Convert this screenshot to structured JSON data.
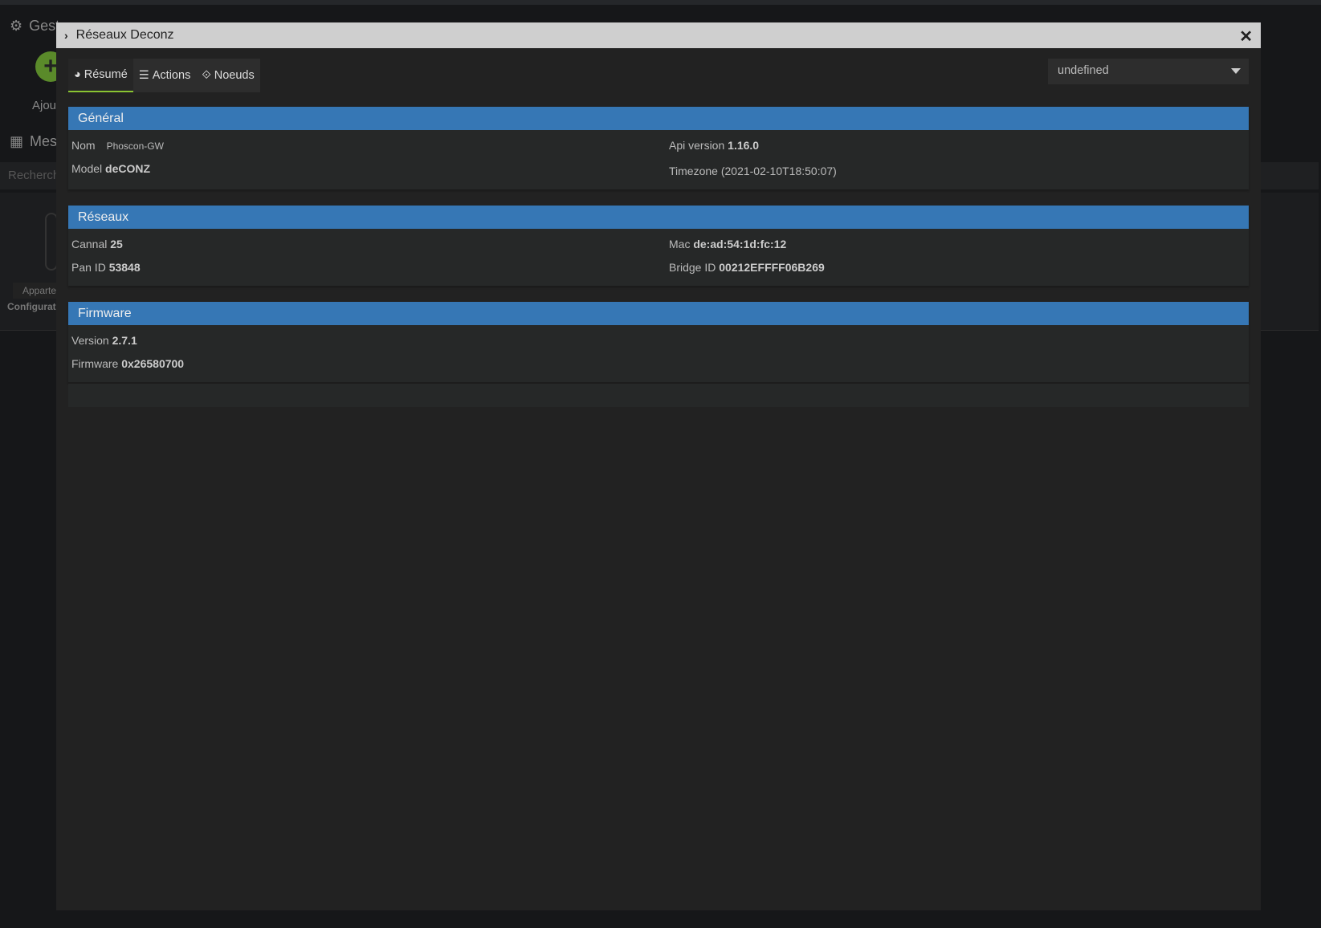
{
  "background": {
    "title": "Gest",
    "add_label": "Ajou",
    "section": "Mes",
    "search_placeholder": "Recherch",
    "device_tag": "Apparte",
    "device_label": "Configurati"
  },
  "modal": {
    "title": "Réseaux Deconz",
    "tabs": [
      {
        "label": "Résumé",
        "icon": "dashboard-icon",
        "active": true
      },
      {
        "label": "Actions",
        "icon": "sliders-icon"
      },
      {
        "label": "Noeuds",
        "icon": "cube-icon"
      }
    ],
    "select_value": "undefined"
  },
  "sections": {
    "general": {
      "title": "Général",
      "nom_label": "Nom",
      "nom_value": "Phoscon-GW",
      "model_label": "Model",
      "model_value": "deCONZ",
      "api_label": "Api version",
      "api_value": "1.16.0",
      "timezone": "Timezone (2021-02-10T18:50:07)"
    },
    "reseaux": {
      "title": "Réseaux",
      "cannal_label": "Cannal",
      "cannal_value": "25",
      "pan_label": "Pan ID",
      "pan_value": "53848",
      "mac_label": "Mac",
      "mac_value": "de:ad:54:1d:fc:12",
      "bridge_label": "Bridge ID",
      "bridge_value": "00212EFFFF06B269"
    },
    "firmware": {
      "title": "Firmware",
      "version_label": "Version",
      "version_value": "2.7.1",
      "firmware_label": "Firmware",
      "firmware_value": "0x26580700"
    }
  },
  "colors": {
    "accent": "#3677b5",
    "tab_active": "#8ac432"
  }
}
